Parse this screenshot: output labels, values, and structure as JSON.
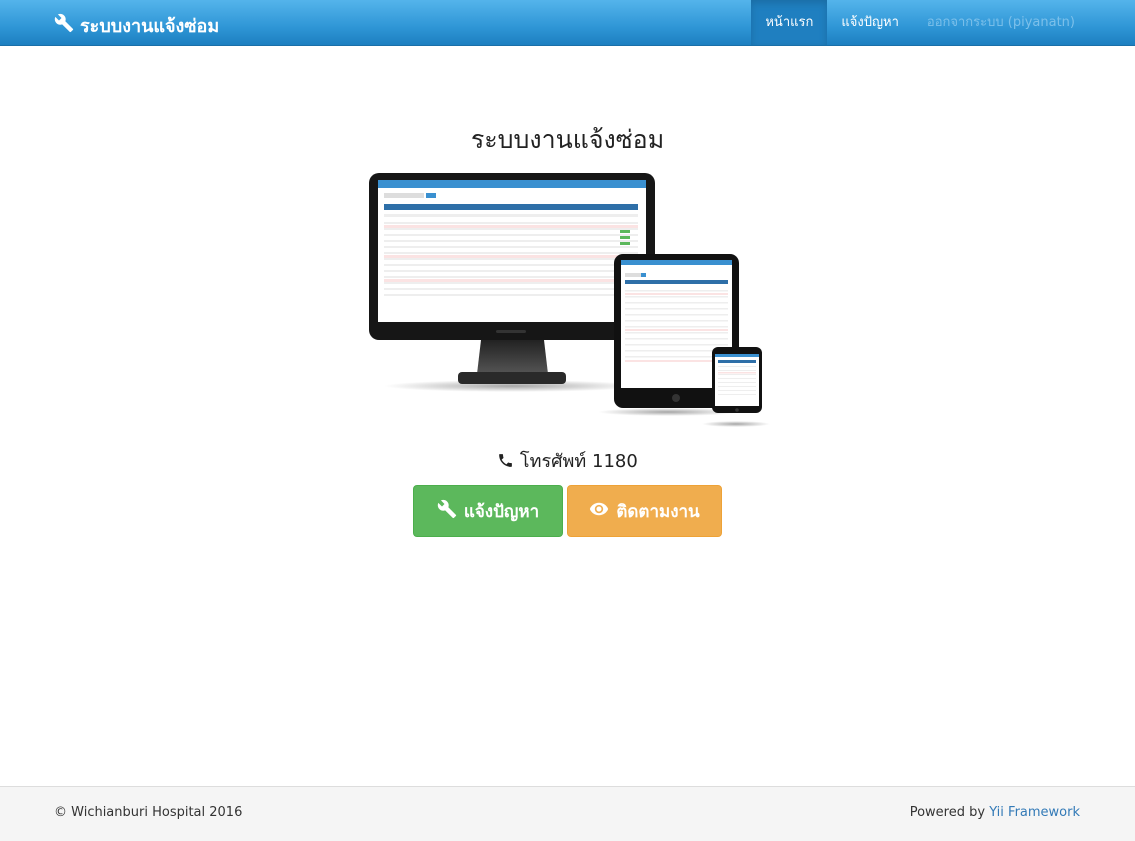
{
  "navbar": {
    "brand": "ระบบงานแจ้งซ่อม",
    "brand_icon": "wrench-icon",
    "items": [
      {
        "label": "หน้าแรก",
        "active": true
      },
      {
        "label": "แจ้งปัญหา",
        "active": false
      },
      {
        "label": "ออกจากระบบ (piyanatn)",
        "active": false
      }
    ]
  },
  "main": {
    "title": "ระบบงานแจ้งซ่อม",
    "phone_icon": "phone-icon",
    "phone": "โทรศัพท์ 1180",
    "buttons": {
      "report": {
        "label": "แจ้งปัญหา",
        "icon": "wrench-icon",
        "color": "#5cb85c"
      },
      "track": {
        "label": "ติดตามงาน",
        "icon": "eye-icon",
        "color": "#f0ad4e"
      }
    }
  },
  "footer": {
    "copyright": "© Wichianburi Hospital 2016",
    "powered_by": "Powered by",
    "framework": "Yii Framework"
  },
  "colors": {
    "navbar": "#2f96d6",
    "link": "#337ab7"
  }
}
